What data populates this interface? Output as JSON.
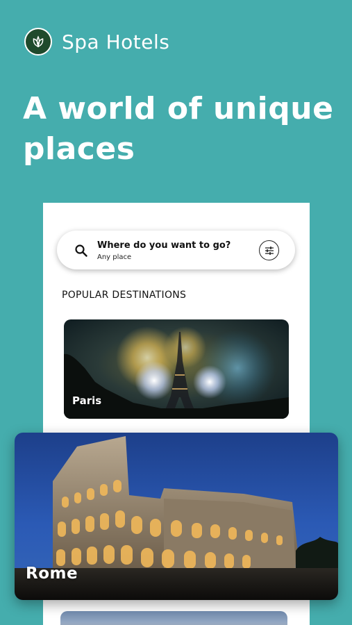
{
  "brand": {
    "name": "Spa Hotels",
    "logo_icon": "leaf-icon",
    "logo_color": "#1f4a2c"
  },
  "hero": {
    "title": "A world of unique places"
  },
  "search": {
    "title": "Where do you want to go?",
    "subtitle": "Any place",
    "icon": "search-icon",
    "filter_icon": "sliders-icon"
  },
  "section": {
    "label": "POPULAR DESTINATIONS"
  },
  "destinations": [
    {
      "label": "Paris"
    },
    {
      "label": "Rome"
    }
  ],
  "colors": {
    "background": "#45adad",
    "card_bg": "#ffffff"
  }
}
